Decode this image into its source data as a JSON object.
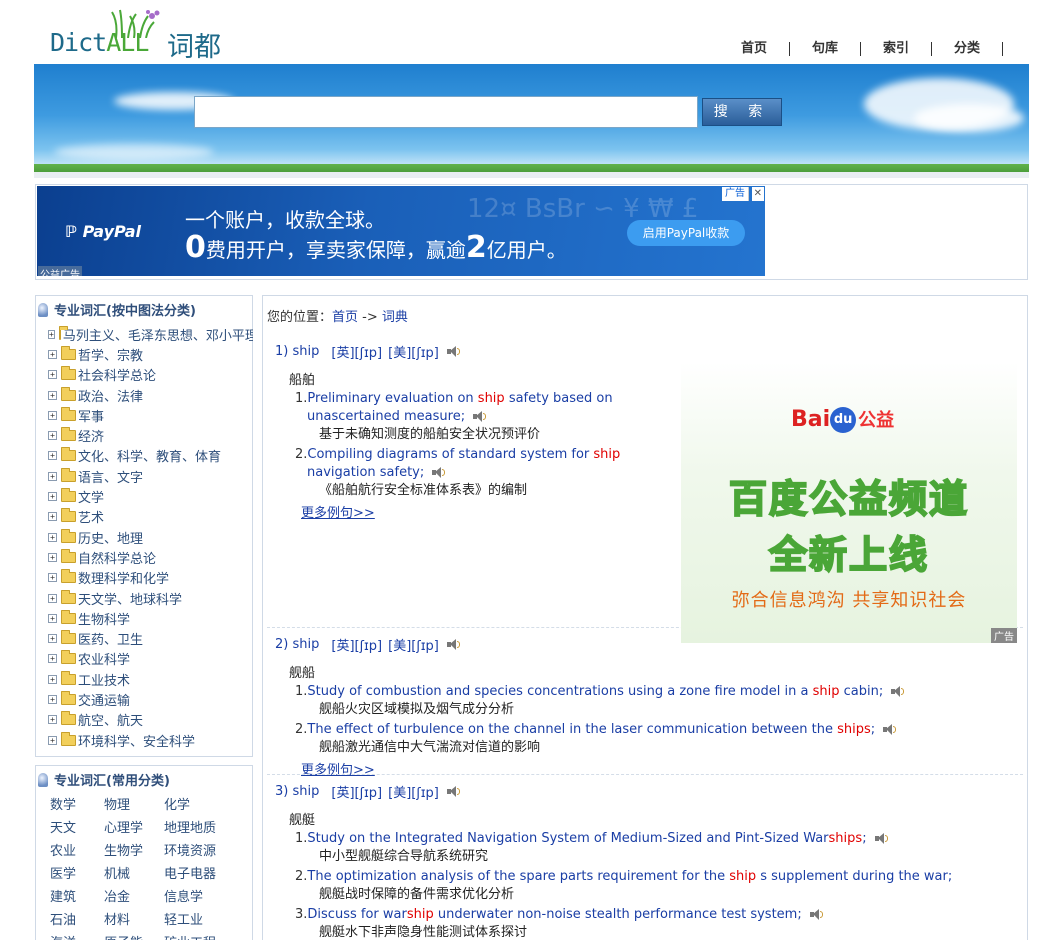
{
  "header": {
    "logo_text_dict": "Dict",
    "logo_text_all": "ALL",
    "logo_text_cn": "词都",
    "nav": [
      "首页",
      "句库",
      "索引",
      "分类"
    ]
  },
  "search": {
    "placeholder": "",
    "button_label": "搜 索"
  },
  "paypal_ad": {
    "brand": "PayPal",
    "line1": "一个账户，收款全球。",
    "line2_prefix_big": "0",
    "line2_mid": "费用开户，享卖家保障，赢逾",
    "line2_big": "2",
    "line2_suffix": "亿用户。",
    "cta": "启用PayPal收款",
    "ad_tag": "广告",
    "close": "✕",
    "public_tag": "公益广告"
  },
  "sidebar": {
    "tree_title": "专业词汇(按中图法分类)",
    "tree_items": [
      "马列主义、毛泽东思想、邓小平理论",
      "哲学、宗教",
      "社会科学总论",
      "政治、法律",
      "军事",
      "经济",
      "文化、科学、教育、体育",
      "语言、文字",
      "文学",
      "艺术",
      "历史、地理",
      "自然科学总论",
      "数理科学和化学",
      "天文学、地球科学",
      "生物科学",
      "医药、卫生",
      "农业科学",
      "工业技术",
      "交通运输",
      "航空、航天",
      "环境科学、安全科学"
    ],
    "common_title": "专业词汇(常用分类)",
    "common_items": [
      "数学",
      "物理",
      "化学",
      "天文",
      "心理学",
      "地理地质",
      "农业",
      "生物学",
      "环境资源",
      "医学",
      "机械",
      "电子电器",
      "建筑",
      "冶金",
      "信息学",
      "石油",
      "材料",
      "轻工业",
      "海洋",
      "原子能",
      "矿业工程"
    ]
  },
  "main": {
    "crumb_prefix": "您的位置：",
    "crumb_home": "首页",
    "crumb_sep": " -> ",
    "crumb_current": "词典",
    "more_label": "更多例句>>",
    "entries": [
      {
        "index": "1)",
        "word": "ship",
        "phonetic_uk": "[英][ʃɪp]",
        "phonetic_us": "[美][ʃɪp]",
        "meaning": "船舶",
        "examples": [
          {
            "num": "1.",
            "pre": "Preliminary evaluation on ",
            "hl": "ship",
            "post": " safety based on unascertained measure;",
            "zh": "基于未确知测度的船舶安全状况预评价"
          },
          {
            "num": "2.",
            "pre": "Compiling diagrams of standard system for ",
            "hl": "ship",
            "post": " navigation safety;",
            "zh": "《船舶航行安全标准体系表》的编制"
          }
        ]
      },
      {
        "index": "2)",
        "word": "ship",
        "phonetic_uk": "[英][ʃɪp]",
        "phonetic_us": "[美][ʃɪp]",
        "meaning": "舰船",
        "examples": [
          {
            "num": "1.",
            "pre": "Study of combustion and species concentrations using a zone fire model in a ",
            "hl": "ship",
            "post": " cabin;",
            "zh": "舰船火灾区域模拟及烟气成分分析"
          },
          {
            "num": "2.",
            "pre": "The effect of turbulence on the channel in the laser communication between the ",
            "hl": "ships",
            "post": ";",
            "zh": "舰船激光通信中大气湍流对信道的影响"
          }
        ]
      },
      {
        "index": "3)",
        "word": "ship",
        "phonetic_uk": "[英][ʃɪp]",
        "phonetic_us": "[美][ʃɪp]",
        "meaning": "舰艇",
        "examples": [
          {
            "num": "1.",
            "pre": "Study on the Integrated Navigation System of Medium-Sized and Pint-Sized War",
            "hl": "ships",
            "post": ";",
            "zh": "中小型舰艇综合导航系统研究"
          },
          {
            "num": "2.",
            "pre": "The optimization analysis of the spare parts requirement for the ",
            "hl": "ship",
            "post": " s supplement during the war;",
            "zh": "舰艇战时保障的备件需求优化分析"
          },
          {
            "num": "3.",
            "pre": "Discuss for war",
            "hl": "ship",
            "post": " underwater non-noise stealth performance test system;",
            "zh": "舰艇水下非声隐身性能测试体系探讨"
          }
        ]
      }
    ]
  },
  "baidu_ad": {
    "logo_bai": "Bai",
    "logo_du": "du",
    "logo_gongyi": "公益",
    "title1": "百度公益频道",
    "title2": "全新上线",
    "slogan": "弥合信息鸿沟 共享知识社会",
    "ad_tag": "广告"
  },
  "colors": {
    "link": "#1a3ea5",
    "highlight": "#e00000",
    "border": "#cfd9e6"
  }
}
